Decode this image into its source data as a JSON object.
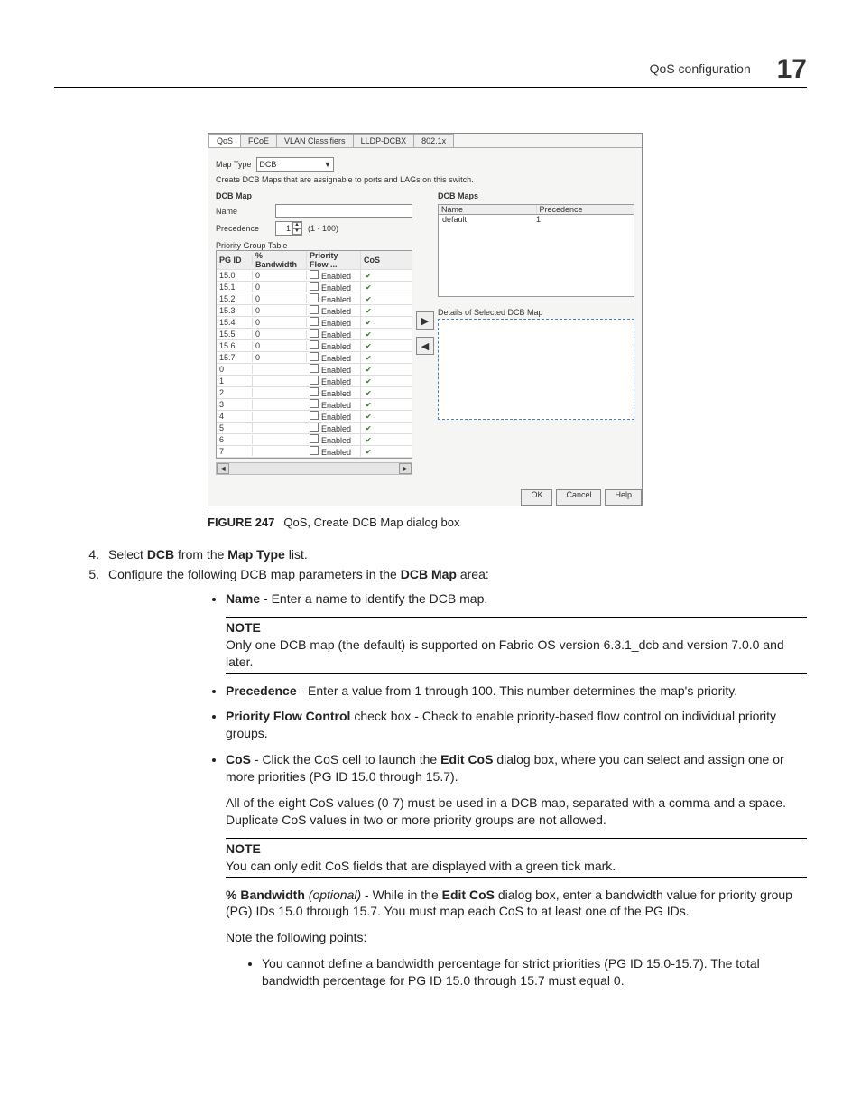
{
  "header": {
    "title": "QoS configuration",
    "chapter": "17"
  },
  "dialog": {
    "tabs": [
      "QoS",
      "FCoE",
      "VLAN Classifiers",
      "LLDP-DCBX",
      "802.1x"
    ],
    "mapTypeLabel": "Map Type",
    "mapTypeValue": "DCB",
    "desc": "Create DCB Maps that are assignable to ports and LAGs on this switch.",
    "dcbMapLabel": "DCB Map",
    "nameLabel": "Name",
    "precedenceLabel": "Precedence",
    "precedenceValue": "1",
    "precedenceRange": "(1 - 100)",
    "pgTableLabel": "Priority Group Table",
    "headers": {
      "pgid": "PG ID",
      "bw": "% Bandwidth",
      "pf": "Priority Flow ...",
      "cos": "CoS"
    },
    "rows": [
      {
        "pgid": "15.0",
        "bw": "0",
        "pf": "Enabled"
      },
      {
        "pgid": "15.1",
        "bw": "0",
        "pf": "Enabled"
      },
      {
        "pgid": "15.2",
        "bw": "0",
        "pf": "Enabled"
      },
      {
        "pgid": "15.3",
        "bw": "0",
        "pf": "Enabled"
      },
      {
        "pgid": "15.4",
        "bw": "0",
        "pf": "Enabled"
      },
      {
        "pgid": "15.5",
        "bw": "0",
        "pf": "Enabled"
      },
      {
        "pgid": "15.6",
        "bw": "0",
        "pf": "Enabled"
      },
      {
        "pgid": "15.7",
        "bw": "0",
        "pf": "Enabled"
      },
      {
        "pgid": "0",
        "bw": "",
        "pf": "Enabled"
      },
      {
        "pgid": "1",
        "bw": "",
        "pf": "Enabled"
      },
      {
        "pgid": "2",
        "bw": "",
        "pf": "Enabled"
      },
      {
        "pgid": "3",
        "bw": "",
        "pf": "Enabled"
      },
      {
        "pgid": "4",
        "bw": "",
        "pf": "Enabled"
      },
      {
        "pgid": "5",
        "bw": "",
        "pf": "Enabled"
      },
      {
        "pgid": "6",
        "bw": "",
        "pf": "Enabled"
      },
      {
        "pgid": "7",
        "bw": "",
        "pf": "Enabled"
      }
    ],
    "right": {
      "title": "DCB Maps",
      "colName": "Name",
      "colPrec": "Precedence",
      "rowName": "default",
      "rowPrec": "1",
      "detailsLabel": "Details of Selected DCB Map"
    },
    "buttons": {
      "ok": "OK",
      "cancel": "Cancel",
      "help": "Help"
    }
  },
  "caption": {
    "label": "FIGURE 247",
    "text": "QoS, Create DCB Map dialog box"
  },
  "steps": {
    "s4num": "4.",
    "s4a": "Select ",
    "s4b": "DCB",
    "s4c": " from the ",
    "s4d": "Map Type",
    "s4e": " list.",
    "s5num": "5.",
    "s5a": "Configure the following DCB map parameters in the ",
    "s5b": "DCB Map",
    "s5c": " area:"
  },
  "bullets": {
    "b1a": "Name",
    "b1b": " - Enter a name to identify the DCB map.",
    "note1lbl": "NOTE",
    "note1": "Only one DCB map (the default) is supported on Fabric OS version 6.3.1_dcb and version 7.0.0 and later.",
    "b2a": "Precedence",
    "b2b": " - Enter a value from 1 through 100. This number determines the map's priority.",
    "b3a": "Priority Flow Control",
    "b3b": " check box - Check to enable priority-based flow control on individual priority groups.",
    "b4a": "CoS",
    "b4b": " - Click the CoS cell to launch the ",
    "b4c": "Edit CoS",
    "b4d": " dialog box, where you can select and assign one or more priorities (PG ID 15.0 through 15.7).",
    "b4p2": "All of the eight CoS values (0-7) must be used in a DCB map, separated with a comma and a space. Duplicate CoS values in two or more priority groups are not allowed.",
    "note2lbl": "NOTE",
    "note2": "You can only edit CoS fields that are displayed with a green tick mark.",
    "bw1": "% Bandwidth",
    "bw2": " (optional)",
    "bw3": " - While in the ",
    "bw4": "Edit CoS",
    "bw5": " dialog box, enter a bandwidth value for priority group (PG) IDs 15.0 through 15.7. You must map each CoS to at least one of the PG IDs.",
    "notePts": "Note the following points:",
    "sb1": "You cannot define a bandwidth percentage for strict priorities (PG ID 15.0-15.7). The total bandwidth percentage for PG ID 15.0 through 15.7 must equal 0."
  }
}
